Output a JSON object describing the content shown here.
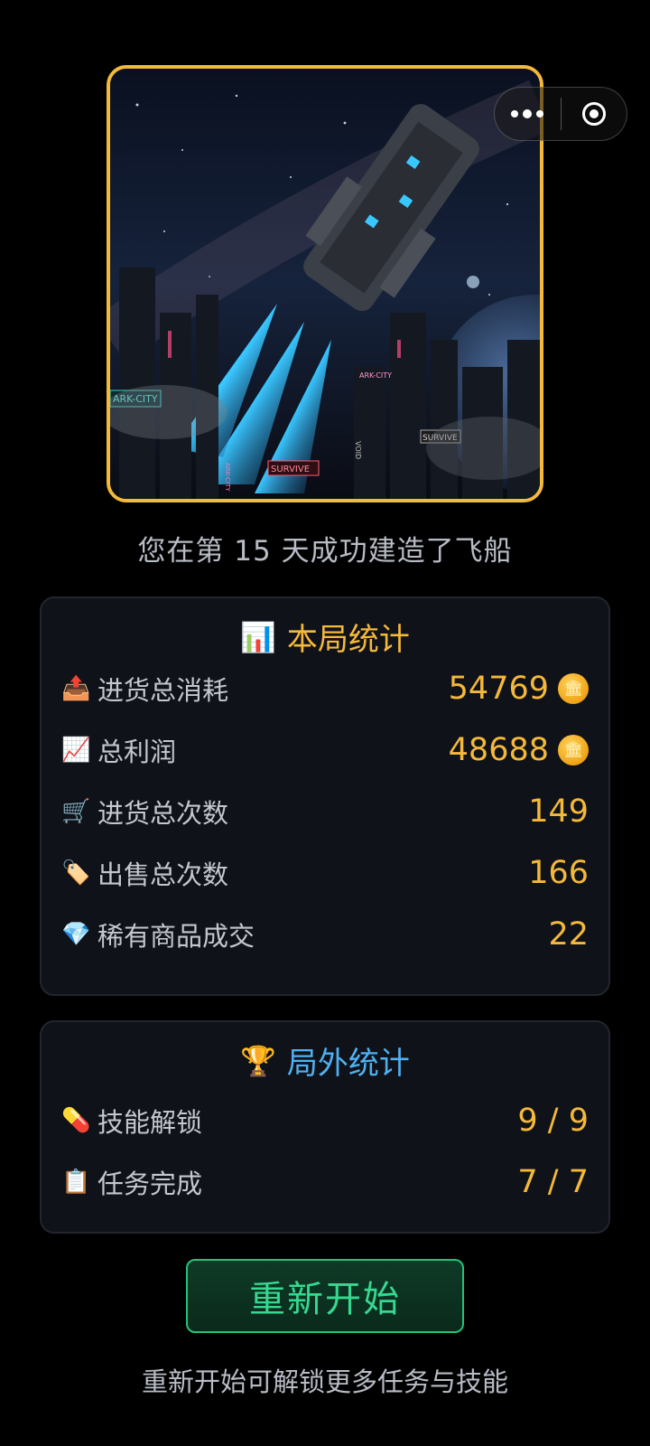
{
  "hero": {
    "image_desc": "spaceship-launch-illustration",
    "signs": [
      "ARK-CITY",
      "ARK-CITY",
      "SURVIVE",
      "SURVIVE",
      "VOID",
      "ARK-CITY"
    ]
  },
  "subtitle": "您在第 15 天成功建造了飞船",
  "run_stats": {
    "title": "本局统计",
    "title_icon": "📊",
    "rows": [
      {
        "icon": "📤",
        "label": "进货总消耗",
        "value": "54769",
        "coin": true
      },
      {
        "icon": "📈",
        "label": "总利润",
        "value": "48688",
        "coin": true
      },
      {
        "icon": "🛒",
        "label": "进货总次数",
        "value": "149",
        "coin": false
      },
      {
        "icon": "🏷️",
        "label": "出售总次数",
        "value": "166",
        "coin": false
      },
      {
        "icon": "💎",
        "label": "稀有商品成交",
        "value": "22",
        "coin": false
      }
    ]
  },
  "meta_stats": {
    "title": "局外统计",
    "title_icon": "🏆",
    "rows": [
      {
        "icon": "💊",
        "label": "技能解锁",
        "value": "9 / 9"
      },
      {
        "icon": "📋",
        "label": "任务完成",
        "value": "7 / 7"
      }
    ]
  },
  "restart_label": "重新开始",
  "hint": "重新开始可解锁更多任务与技能",
  "colors": {
    "gold": "#f4b93a",
    "blue": "#4fb1f2",
    "green": "#35d990"
  }
}
